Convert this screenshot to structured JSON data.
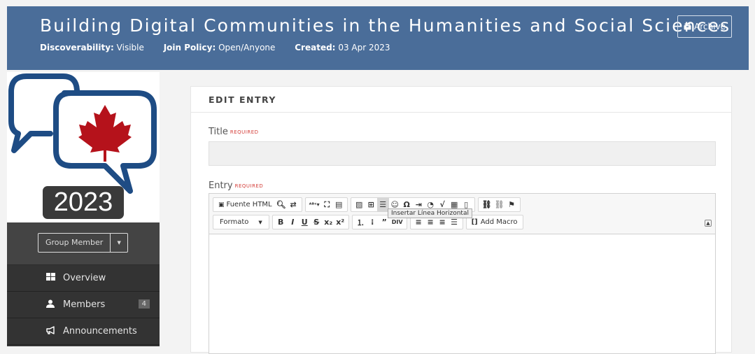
{
  "group": {
    "title": "Building Digital Communities in the Humanities and Social Sciences",
    "meta": [
      {
        "label": "Discoverability:",
        "value": "Visible"
      },
      {
        "label": "Join Policy:",
        "value": "Open/Anyone"
      },
      {
        "label": "Created:",
        "value": "03 Apr 2023"
      }
    ],
    "archive_label": "Archive"
  },
  "logo": {
    "year": "2023"
  },
  "sidebar": {
    "membership_label": "Group Member",
    "items": [
      {
        "label": "Overview",
        "icon": "grid-icon"
      },
      {
        "label": "Members",
        "icon": "user-icon",
        "count": "4"
      },
      {
        "label": "Announcements",
        "icon": "bullhorn-icon"
      }
    ]
  },
  "form": {
    "heading": "EDIT ENTRY",
    "title_label": "Title",
    "entry_label": "Entry",
    "required": "REQUIRED",
    "title_value": ""
  },
  "editor": {
    "source_label": "Fuente HTML",
    "format_label": "Formato",
    "add_macro_label": "Add Macro",
    "tooltip": "Insertar Línea Horizontal",
    "content": ""
  },
  "colors": {
    "header": "#4a6d99",
    "sidebar": "#333333",
    "required": "#d43f3a"
  }
}
